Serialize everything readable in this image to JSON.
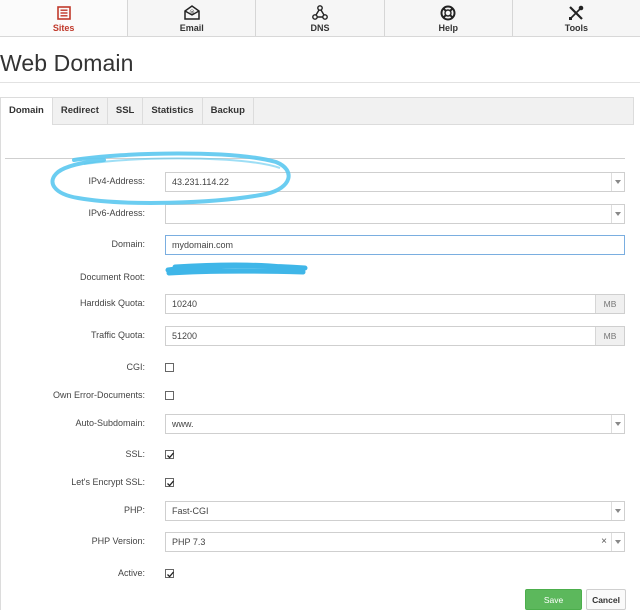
{
  "nav": {
    "items": [
      {
        "label": "Sites",
        "icon": "sites-icon",
        "active": true
      },
      {
        "label": "Email",
        "icon": "email-icon"
      },
      {
        "label": "DNS",
        "icon": "dns-icon"
      },
      {
        "label": "Help",
        "icon": "help-icon"
      },
      {
        "label": "Tools",
        "icon": "tools-icon"
      }
    ]
  },
  "page": {
    "title": "Web Domain"
  },
  "tabs": [
    "Domain",
    "Redirect",
    "SSL",
    "Statistics",
    "Backup"
  ],
  "form": {
    "ipv4": {
      "label": "IPv4-Address:",
      "value": "43.231.114.22"
    },
    "ipv6": {
      "label": "IPv6-Address:",
      "value": ""
    },
    "domain": {
      "label": "Domain:",
      "value": "mydomain.com"
    },
    "docroot": {
      "label": "Document Root:"
    },
    "hdd": {
      "label": "Harddisk Quota:",
      "value": "10240",
      "unit": "MB"
    },
    "traffic": {
      "label": "Traffic Quota:",
      "value": "51200",
      "unit": "MB"
    },
    "cgi": {
      "label": "CGI:",
      "checked": false
    },
    "errdocs": {
      "label": "Own Error-Documents:",
      "checked": false
    },
    "autosub": {
      "label": "Auto-Subdomain:",
      "value": "www."
    },
    "ssl": {
      "label": "SSL:",
      "checked": true
    },
    "le": {
      "label": "Let's Encrypt SSL:",
      "checked": true
    },
    "php": {
      "label": "PHP:",
      "value": "Fast-CGI"
    },
    "phpver": {
      "label": "PHP Version:",
      "value": "PHP 7.3",
      "clear": "×"
    },
    "active": {
      "label": "Active:",
      "checked": true
    }
  },
  "buttons": {
    "save": "Save",
    "cancel": "Cancel"
  },
  "colors": {
    "accent_active": "#c0392b",
    "save": "#5cb85c",
    "scribble": "#5bc8ef"
  }
}
